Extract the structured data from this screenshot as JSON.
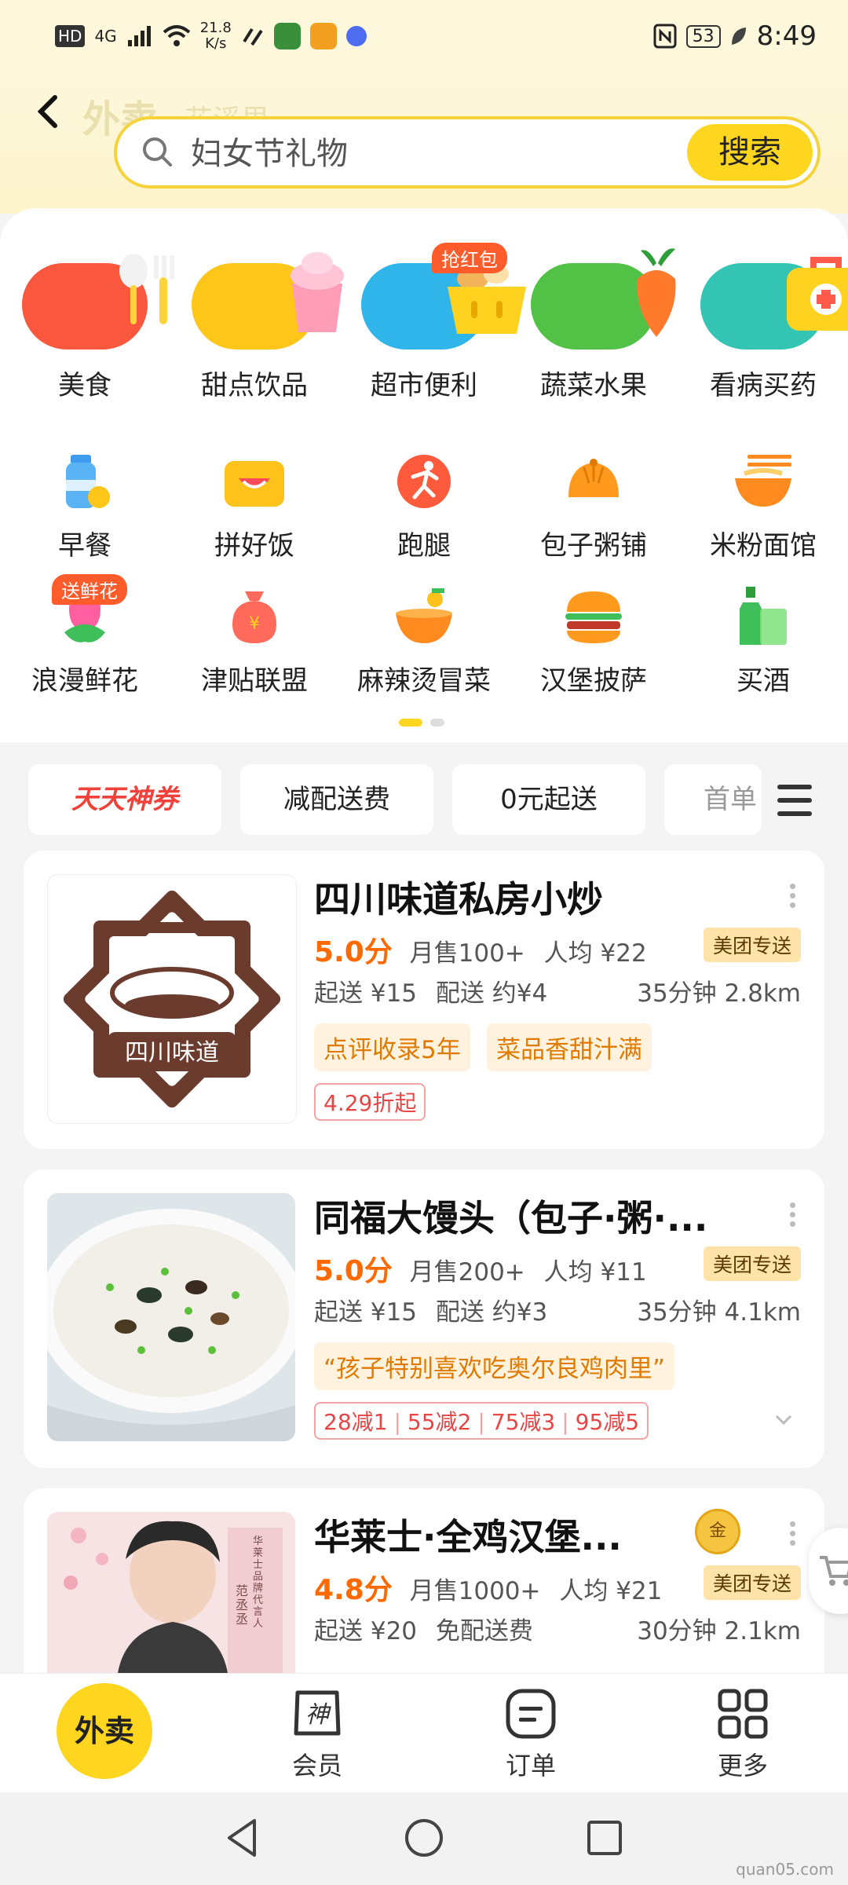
{
  "status_bar": {
    "hd": "HD",
    "network": "4G",
    "speed_value": "21.8",
    "speed_unit": "K/s",
    "battery": "53",
    "time": "8:49"
  },
  "header": {
    "title_ghost": "外卖",
    "location_ghost": "花溪里",
    "search_placeholder": "妇女节礼物",
    "search_button": "搜索"
  },
  "categories_primary": [
    {
      "label": "美食",
      "icon": "tableware-icon"
    },
    {
      "label": "甜点饮品",
      "icon": "dessert-icon"
    },
    {
      "label": "超市便利",
      "icon": "shopping-basket-icon",
      "badge": "抢红包"
    },
    {
      "label": "蔬菜水果",
      "icon": "vegetable-icon"
    },
    {
      "label": "看病买药",
      "icon": "medicine-kit-icon"
    }
  ],
  "categories_secondary": [
    {
      "label": "早餐",
      "icon": "milk-bottle-icon"
    },
    {
      "label": "拼好饭",
      "icon": "lunchbox-icon"
    },
    {
      "label": "跑腿",
      "icon": "runner-icon"
    },
    {
      "label": "包子粥铺",
      "icon": "bun-icon"
    },
    {
      "label": "米粉面馆",
      "icon": "noodle-bowl-icon"
    },
    {
      "label": "浪漫鲜花",
      "icon": "flower-icon",
      "badge": "送鲜花"
    },
    {
      "label": "津贴联盟",
      "icon": "money-bag-icon"
    },
    {
      "label": "麻辣烫冒菜",
      "icon": "hotpot-bowl-icon"
    },
    {
      "label": "汉堡披萨",
      "icon": "burger-icon"
    },
    {
      "label": "买酒",
      "icon": "wine-bottle-icon"
    }
  ],
  "filters": [
    "天天神券",
    "减配送费",
    "0元起送",
    "首单"
  ],
  "stores": [
    {
      "name": "四川味道私房小炒",
      "logo_text": "四川味道",
      "score": "5.0分",
      "monthly_sales": "月售100+",
      "avg_price": "人均 ¥22",
      "badge": "美团专送",
      "min_order": "起送 ¥15",
      "delivery_fee": "配送 约¥4",
      "time_distance": "35分钟 2.8km",
      "tags": [
        "点评收录5年",
        "菜品香甜汁满"
      ],
      "discounts": [
        "4.29折起"
      ]
    },
    {
      "name": "同福大馒头（包子·粥·...",
      "score": "5.0分",
      "monthly_sales": "月售200+",
      "avg_price": "人均 ¥11",
      "badge": "美团专送",
      "min_order": "起送 ¥15",
      "delivery_fee": "配送 约¥3",
      "time_distance": "35分钟 4.1km",
      "tags": [
        "“孩子特别喜欢吃奥尔良鸡肉里”"
      ],
      "discounts": [
        "28减1",
        "55减2",
        "75减3",
        "95减5"
      ]
    },
    {
      "name": "华莱士·全鸡汉堡...",
      "gold_badge": "金",
      "score": "4.8分",
      "monthly_sales": "月售1000+",
      "avg_price": "人均 ¥21",
      "badge": "美团专送",
      "min_order": "起送 ¥20",
      "delivery_fee": "免配送费",
      "time_distance": "30分钟 2.1km",
      "ad_text": "华莱士品牌代言人",
      "ad_name": "范丞丞"
    }
  ],
  "bottom_nav": {
    "home": "外卖",
    "member": "会员",
    "member_glyph": "神",
    "orders": "订单",
    "more": "更多"
  },
  "watermark": "quan05.com",
  "colors": {
    "brand_yellow": "#ffd61f",
    "score_orange": "#ff6a00",
    "discount_red": "#e84545"
  }
}
